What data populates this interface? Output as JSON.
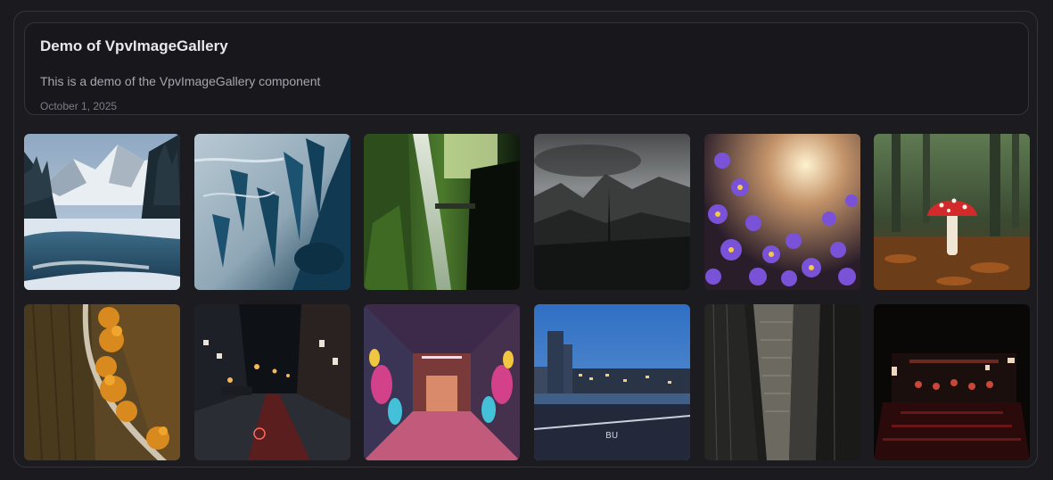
{
  "header": {
    "title": "Demo of VpvImageGallery",
    "description": "This is a demo of the VpvImageGallery component",
    "date": "October 1, 2025"
  },
  "gallery": {
    "images": [
      {
        "subject": "snowy-mountain-river"
      },
      {
        "subject": "frozen-ice-aerial"
      },
      {
        "subject": "forest-waterfall"
      },
      {
        "subject": "dark-misty-mountains"
      },
      {
        "subject": "purple-flowers-sunset"
      },
      {
        "subject": "red-mushroom-forest"
      },
      {
        "subject": "autumn-road-aerial"
      },
      {
        "subject": "night-city-street"
      },
      {
        "subject": "graffiti-tunnel"
      },
      {
        "subject": "city-waterfront-dusk"
      },
      {
        "subject": "dark-skyscrapers"
      },
      {
        "subject": "dark-restaurant-night"
      }
    ]
  }
}
